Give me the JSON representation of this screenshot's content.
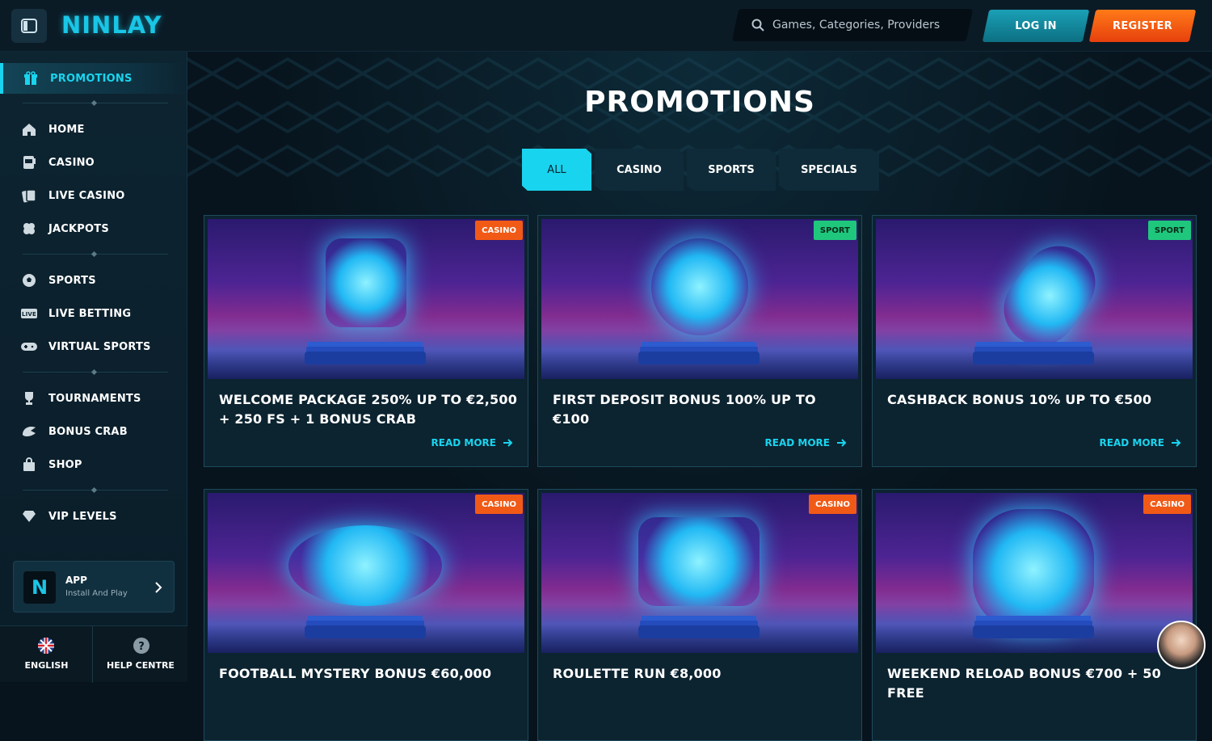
{
  "header": {
    "brand": "NINLAY",
    "search_placeholder": "Games, Categories, Providers",
    "login_label": "LOG IN",
    "register_label": "REGISTER"
  },
  "sidebar": {
    "active": {
      "label": "PROMOTIONS"
    },
    "groups": [
      [
        {
          "label": "HOME"
        },
        {
          "label": "CASINO"
        },
        {
          "label": "LIVE CASINO"
        },
        {
          "label": "JACKPOTS"
        }
      ],
      [
        {
          "label": "SPORTS"
        },
        {
          "label": "LIVE BETTING"
        },
        {
          "label": "VIRTUAL SPORTS"
        }
      ],
      [
        {
          "label": "TOURNAMENTS"
        },
        {
          "label": "BONUS CRAB"
        },
        {
          "label": "SHOP"
        }
      ],
      [
        {
          "label": "VIP LEVELS"
        }
      ]
    ],
    "app": {
      "title": "APP",
      "subtitle": "Install And Play"
    },
    "language_label": "ENGLISH",
    "help_label": "HELP CENTRE"
  },
  "main": {
    "title": "PROMOTIONS",
    "tabs": [
      "ALL",
      "CASINO",
      "SPORTS",
      "SPECIALS"
    ],
    "read_more_label": "READ MORE",
    "cards": [
      {
        "badge": "CASINO",
        "title": "WELCOME PACKAGE 250% UP TO €2,500 + 250 FS + 1 BONUS CRAB"
      },
      {
        "badge": "SPORT",
        "title": "FIRST DEPOSIT BONUS 100% UP TO €100"
      },
      {
        "badge": "SPORT",
        "title": "CASHBACK BONUS 10% UP TO €500"
      },
      {
        "badge": "CASINO",
        "title": "FOOTBALL MYSTERY BONUS €60,000"
      },
      {
        "badge": "CASINO",
        "title": "ROULETTE RUN €8,000"
      },
      {
        "badge": "CASINO",
        "title": "WEEKEND RELOAD BONUS €700 + 50 FREE"
      }
    ]
  },
  "colors": {
    "accent": "#19d4ee",
    "casino_badge": "#f15a16",
    "sport_badge": "#1fc77d",
    "register": "#ff7a18"
  }
}
